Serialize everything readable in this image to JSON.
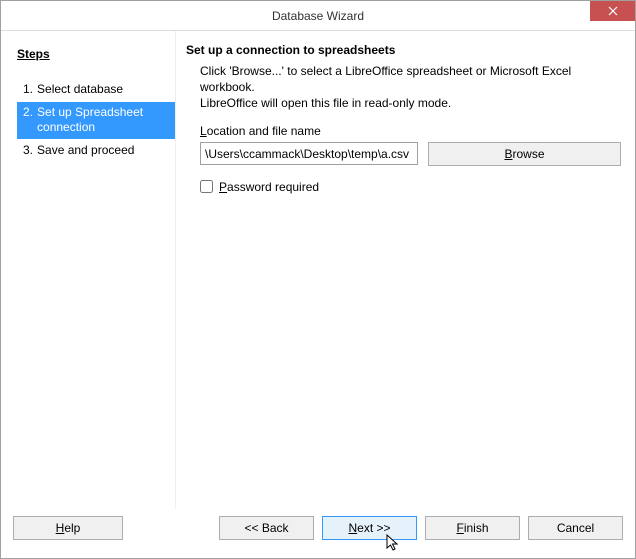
{
  "window": {
    "title": "Database Wizard"
  },
  "sidebar": {
    "heading": "Steps",
    "items": [
      {
        "number": "1.",
        "label": "Select database"
      },
      {
        "number": "2.",
        "label": "Set up Spreadsheet connection"
      },
      {
        "number": "3.",
        "label": "Save and proceed"
      }
    ]
  },
  "main": {
    "heading": "Set up a connection to spreadsheets",
    "instruction": "Click 'Browse...' to select a LibreOffice spreadsheet or Microsoft Excel workbook.\nLibreOffice will open this file in read-only mode.",
    "location_label_prefix": "L",
    "location_label_rest": "ocation and file name",
    "location_value": "\\Users\\ccammack\\Desktop\\temp\\a.csv",
    "browse_prefix": "B",
    "browse_rest": "rowse",
    "password_checked": false,
    "password_prefix": "P",
    "password_rest": "assword required"
  },
  "buttons": {
    "help_prefix": "H",
    "help_rest": "elp",
    "back": "<< Back",
    "next_prefix": "N",
    "next_rest": "ext >>",
    "finish_prefix": "F",
    "finish_rest": "inish",
    "cancel": "Cancel"
  }
}
